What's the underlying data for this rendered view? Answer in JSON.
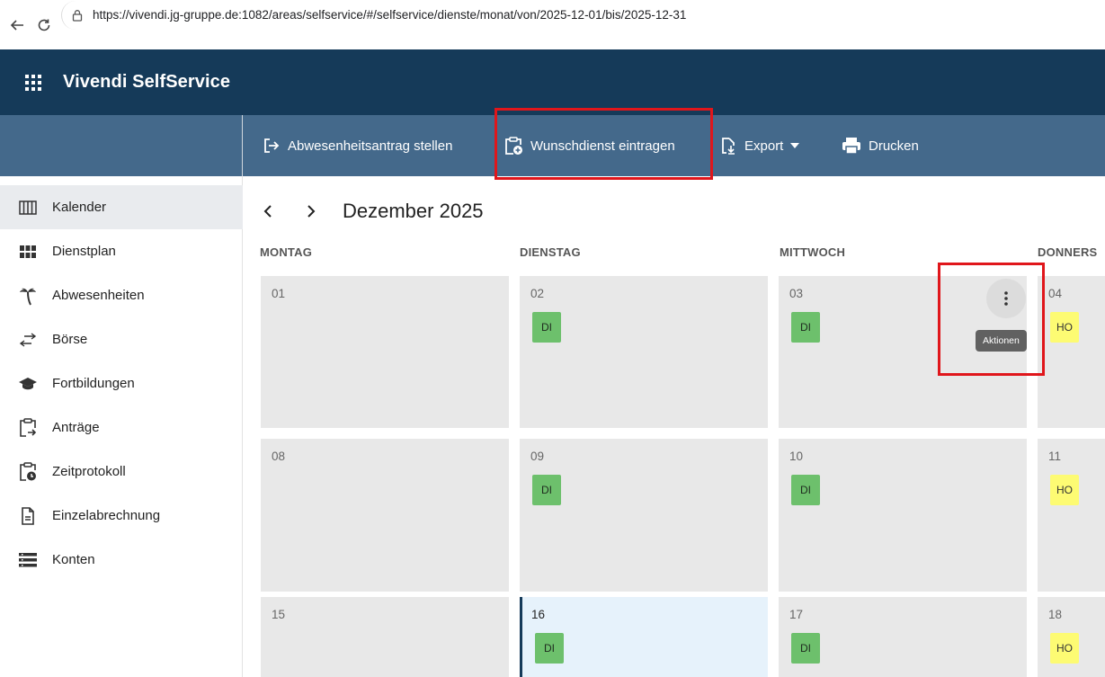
{
  "browser": {
    "url": "https://vivendi.jg-gruppe.de:1082/areas/selfservice/#/selfservice/dienste/monat/von/2025-12-01/bis/2025-12-31"
  },
  "app": {
    "title": "Vivendi SelfService"
  },
  "toolbar": {
    "absence_label": "Abwesenheitsantrag stellen",
    "wish_label": "Wunschdienst eintragen",
    "export_label": "Export",
    "print_label": "Drucken"
  },
  "sidebar": {
    "items": [
      {
        "label": "Kalender",
        "icon": "calendar-columns-icon",
        "active": true
      },
      {
        "label": "Dienstplan",
        "icon": "grid-icon"
      },
      {
        "label": "Abwesenheiten",
        "icon": "palm-tree-icon"
      },
      {
        "label": "Börse",
        "icon": "swap-arrows-icon"
      },
      {
        "label": "Fortbildungen",
        "icon": "graduation-cap-icon"
      },
      {
        "label": "Anträge",
        "icon": "clipboard-arrow-icon"
      },
      {
        "label": "Zeitprotokoll",
        "icon": "clipboard-clock-icon"
      },
      {
        "label": "Einzelabrechnung",
        "icon": "document-icon"
      },
      {
        "label": "Konten",
        "icon": "list-icon"
      }
    ]
  },
  "calendar": {
    "month_title": "Dezember 2025",
    "weekdays": [
      "MONTAG",
      "DIENSTAG",
      "MITTWOCH",
      "DONNERS"
    ],
    "weeks": [
      [
        {
          "day": "01",
          "shift": ""
        },
        {
          "day": "02",
          "shift": "DI"
        },
        {
          "day": "03",
          "shift": "DI"
        },
        {
          "day": "04",
          "shift": "HO"
        }
      ],
      [
        {
          "day": "08",
          "shift": ""
        },
        {
          "day": "09",
          "shift": "DI"
        },
        {
          "day": "10",
          "shift": "DI"
        },
        {
          "day": "11",
          "shift": "HO"
        }
      ],
      [
        {
          "day": "15",
          "shift": ""
        },
        {
          "day": "16",
          "shift": "DI"
        },
        {
          "day": "17",
          "shift": "DI"
        },
        {
          "day": "18",
          "shift": "HO"
        }
      ]
    ],
    "actions_tooltip": "Aktionen"
  },
  "colors": {
    "header": "#153a59",
    "toolbar": "#44698b",
    "shift_di": "#6dc06c",
    "shift_ho": "#fdfb73",
    "highlight": "#e0161b"
  }
}
